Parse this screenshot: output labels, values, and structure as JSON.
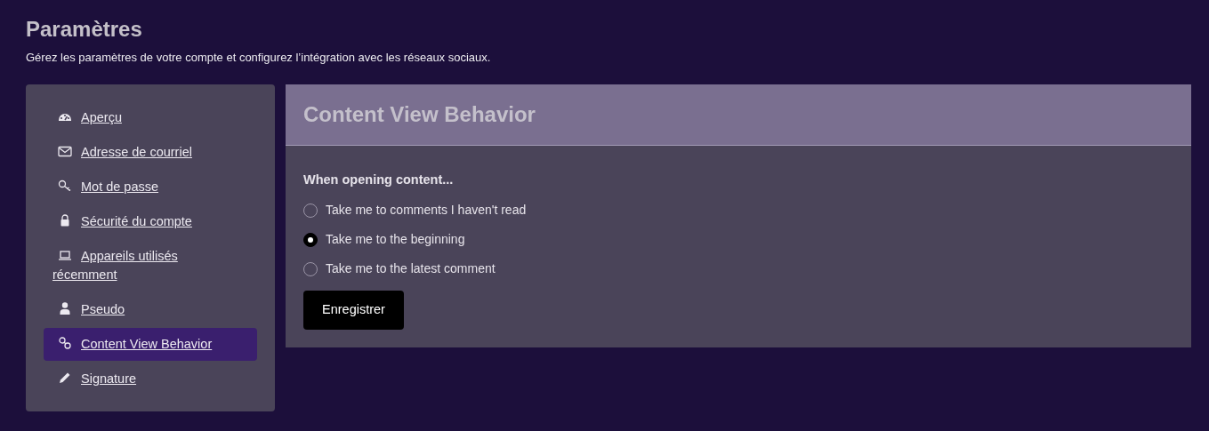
{
  "page": {
    "title": "Paramètres",
    "subtitle": "Gérez les paramètres de votre compte et configurez l’intégration avec les réseaux sociaux."
  },
  "sidebar": {
    "items": [
      {
        "label": "Aperçu",
        "kind": "gauge",
        "selected": false
      },
      {
        "label": "Adresse de courriel",
        "kind": "envelope",
        "selected": false
      },
      {
        "label": "Mot de passe",
        "kind": "key",
        "selected": false
      },
      {
        "label": "Sécurité du compte",
        "kind": "lock",
        "selected": false
      },
      {
        "label": "Appareils utilisés récemment",
        "kind": "laptop",
        "selected": false
      },
      {
        "label": "Pseudo",
        "kind": "user",
        "selected": false
      },
      {
        "label": "Content View Behavior",
        "kind": "link",
        "selected": true
      },
      {
        "label": "Signature",
        "kind": "pencil",
        "selected": false
      }
    ]
  },
  "panel": {
    "title": "Content View Behavior",
    "question": "When opening content...",
    "options": [
      {
        "label": "Take me to comments I haven't read",
        "selected": false
      },
      {
        "label": "Take me to the beginning",
        "selected": true
      },
      {
        "label": "Take me to the latest comment",
        "selected": false
      }
    ],
    "button": "Enregistrer"
  }
}
